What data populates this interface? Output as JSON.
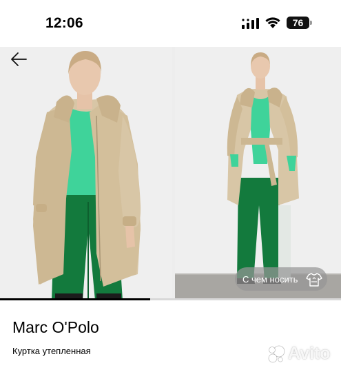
{
  "status_bar": {
    "time": "12:06",
    "battery_level": "76"
  },
  "gallery": {
    "photo_count": 2,
    "progress": 0.44,
    "wear_with_label": "С чем носить"
  },
  "product": {
    "brand": "Marc O'Polo",
    "title": "Куртка утепленная"
  },
  "watermark": {
    "text": "Avito"
  },
  "colors": {
    "coat": "#d8c6a6",
    "sweater": "#3fd39a",
    "trousers": "#137a3d",
    "background": "#ededed"
  }
}
